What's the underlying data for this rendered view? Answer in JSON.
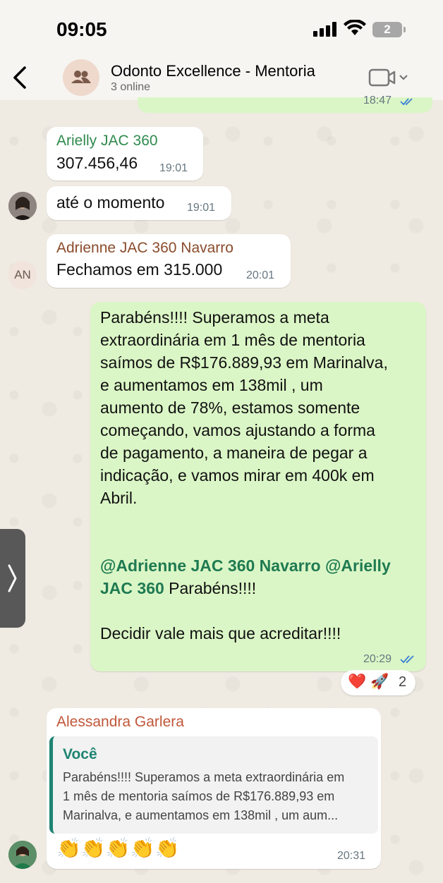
{
  "status_bar": {
    "time": "09:05",
    "battery": "2"
  },
  "header": {
    "title": "Odonto Excellence - Mentoria",
    "subtitle": "3 online"
  },
  "messages": [
    {
      "time": "18:47"
    },
    {
      "sender": "Arielly JAC 360",
      "text": "307.456,46",
      "time": "19:01"
    },
    {
      "text": "até o momento",
      "time": "19:01"
    },
    {
      "sender": "Adrienne JAC 360 Navarro",
      "text": "Fechamos em 315.000",
      "time": "20:01",
      "avatar_initials": "AN"
    },
    {
      "lines": [
        "Parabéns!!!! Superamos a meta",
        "extraordinária em 1 mês de mentoria",
        "saímos de  R$176.889,93 em Marinalva,",
        "e aumentamos em 138mil ,  um",
        "aumento de 78%, estamos somente",
        "começando, vamos ajustando a forma",
        "de pagamento, a maneira de pegar a",
        "indicação, e vamos mirar em 400k em",
        "Abril."
      ],
      "mention1": "@Adrienne JAC 360 Navarro",
      "mention2a": "@Arielly",
      "mention2b": "JAC 360",
      "mention_tail": " Parabéns!!!!",
      "closing": "Decidir vale mais que acreditar!!!!",
      "time": "20:29",
      "reactions": {
        "emojis": "❤️ 🚀",
        "count": "2"
      }
    },
    {
      "sender": "Alessandra Garlera",
      "quote_author": "Você",
      "quote_lines": [
        "Parabéns!!!! Superamos a meta extraordinária em",
        "1 mês de mentoria saímos de  R$176.889,93 em",
        "Marinalva, e aumentamos em 138mil ,  um aum..."
      ],
      "text": "👏👏👏👏👏",
      "time": "20:31"
    }
  ],
  "colors": {
    "outgoing_bubble": "#dbf6c6",
    "incoming_bubble": "#ffffff",
    "sender_arielly": "#2f8a4e",
    "sender_adrienne": "#8a4b2b",
    "sender_alessandra": "#c0573a",
    "read_ticks": "#3b82d6"
  }
}
